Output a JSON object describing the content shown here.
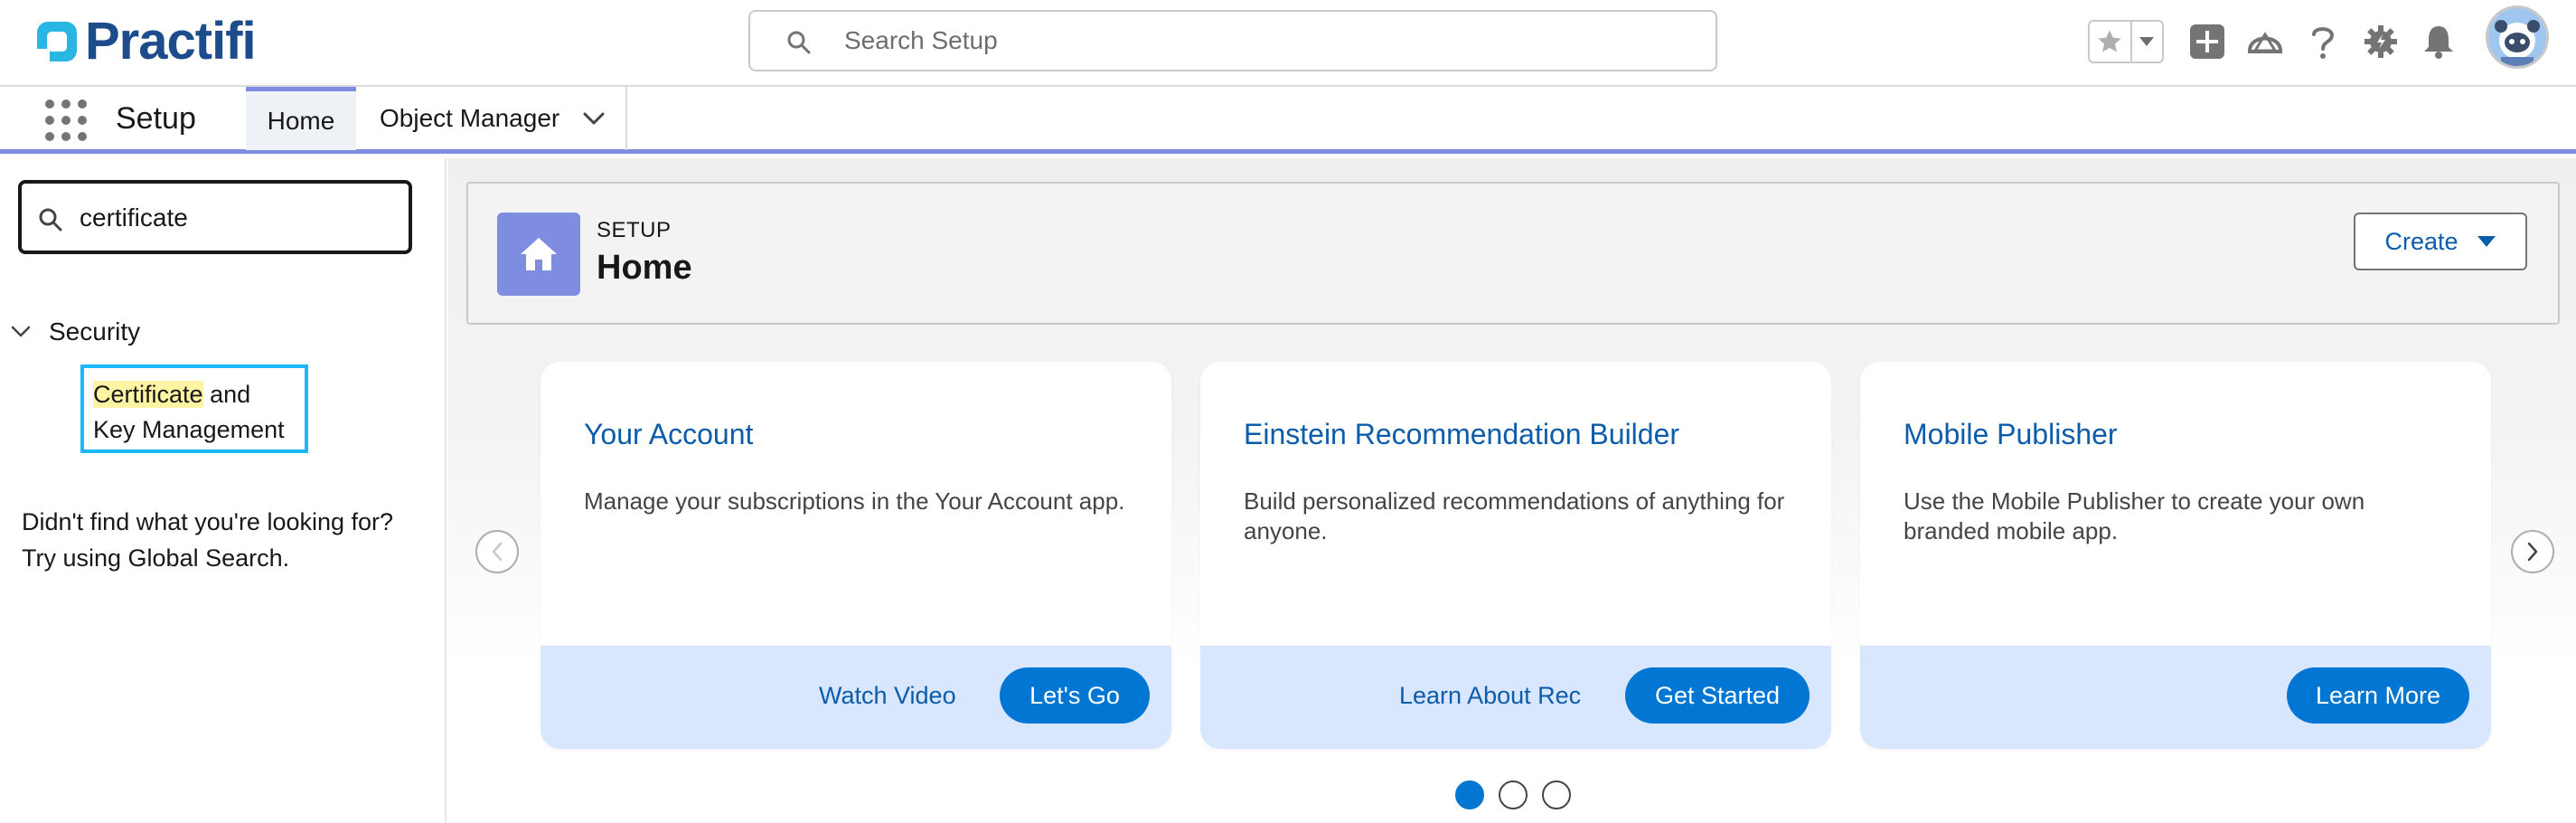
{
  "brand": {
    "name": "Practifi",
    "color": "#1c4c8c",
    "accent": "#7f8de1"
  },
  "header": {
    "search_placeholder": "Search Setup",
    "icons": [
      "favorites-star-icon",
      "favorites-dropdown-icon",
      "global-actions-add-icon",
      "trailhead-icon",
      "help-icon",
      "setup-gear-icon",
      "notifications-bell-icon",
      "user-avatar"
    ]
  },
  "nav": {
    "app_name": "Setup",
    "tabs": [
      {
        "label": "Home",
        "active": true
      },
      {
        "label": "Object Manager",
        "active": false
      }
    ]
  },
  "sidebar": {
    "quick_find_value": "certificate",
    "tree": {
      "section_label": "Security",
      "result_highlight": "Certificate",
      "result_rest": "and Key Management"
    },
    "no_results_line1": "Didn't find what you're looking for?",
    "no_results_line2": "Try using Global Search."
  },
  "page_header": {
    "eyebrow": "SETUP",
    "title": "Home",
    "create_label": "Create"
  },
  "cards": [
    {
      "title": "Your Account",
      "description": "Manage your subscriptions in the Your Account app.",
      "link_label": "Watch Video",
      "button_label": "Let's Go"
    },
    {
      "title": "Einstein Recommendation Builder",
      "description": "Build personalized recommendations of anything for anyone.",
      "link_label": "Learn About Rec",
      "button_label": "Get Started"
    },
    {
      "title": "Mobile Publisher",
      "description": "Use the Mobile Publisher to create your own branded mobile app.",
      "link_label": "",
      "button_label": "Learn More"
    }
  ],
  "carousel": {
    "pages": 3,
    "active_page": 1
  }
}
